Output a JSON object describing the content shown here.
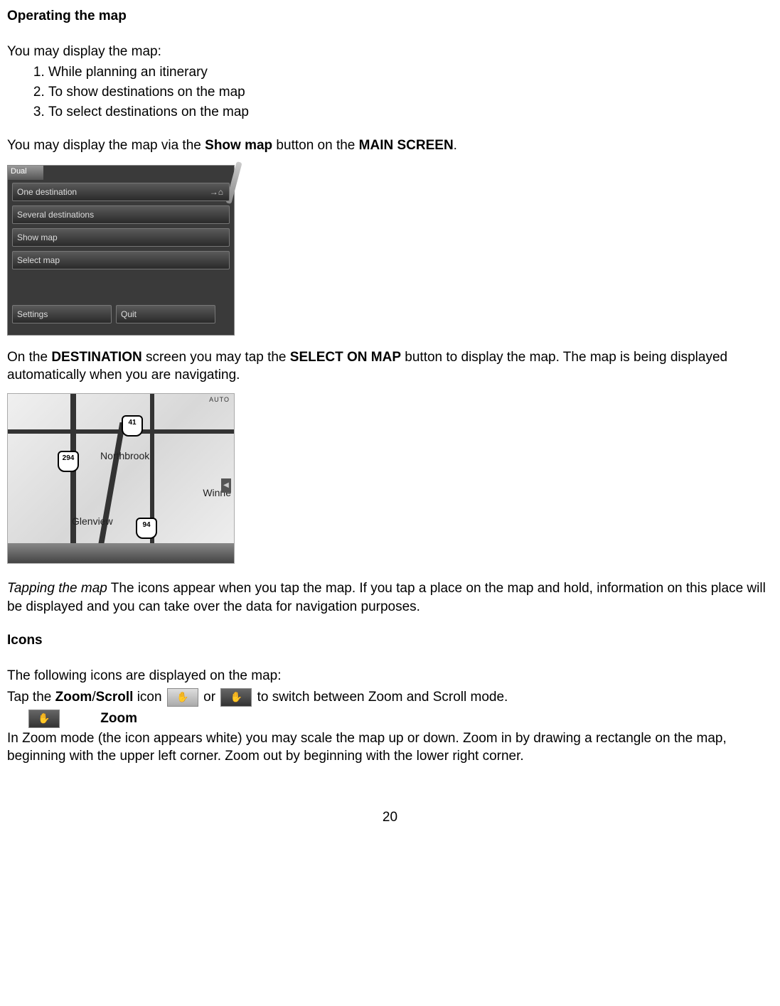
{
  "heading1": "Operating the map",
  "intro": "You may display the map:",
  "list": [
    "While planning an itinerary",
    "To show destinations on the map",
    "To select destinations on the map"
  ],
  "para2_a": "You may display the map via the ",
  "para2_b": "Show map",
  "para2_c": " button on the ",
  "para2_d": "MAIN SCREEN",
  "para2_e": ".",
  "menu": {
    "dual": "Dual",
    "one_dest": "One destination",
    "several": "Several destinations",
    "show_map": "Show map",
    "select_map": "Select map",
    "settings": "Settings",
    "quit": "Quit"
  },
  "para3_a": "On the ",
  "para3_b": "DESTINATION",
  "para3_c": " screen you may tap the ",
  "para3_d": "SELECT ON MAP",
  "para3_e": " button to display the map. The map is being displayed automatically when you are navigating.",
  "map": {
    "auto": "AUTO",
    "shield1_top": "41",
    "shield2_top": "294",
    "shield3_top": "94",
    "city1": "Northbrook",
    "city2": "Glenview",
    "city3": "Winne"
  },
  "tapping_label": "Tapping the map",
  "tapping_text": " The icons appear when you tap the map. If you tap a place on the map and hold, information on this place will be displayed and you can take over the data for navigation purposes.",
  "icons_heading": "Icons",
  "icons_intro": "The following icons are displayed on the map:",
  "tap_a": "Tap the ",
  "tap_b": "Zoom",
  "tap_c": "/",
  "tap_d": "Scroll",
  "tap_e": " icon ",
  "tap_f": " or ",
  "tap_g": " to switch between Zoom and Scroll mode.",
  "hand_glyph": "✋",
  "zoom_label": "Zoom",
  "zoom_para": "In Zoom mode (the icon appears white) you may scale the map up or down. Zoom in by drawing a rectangle on the map, beginning with the upper left corner. Zoom out by beginning with the lower right corner.",
  "page_number": "20"
}
